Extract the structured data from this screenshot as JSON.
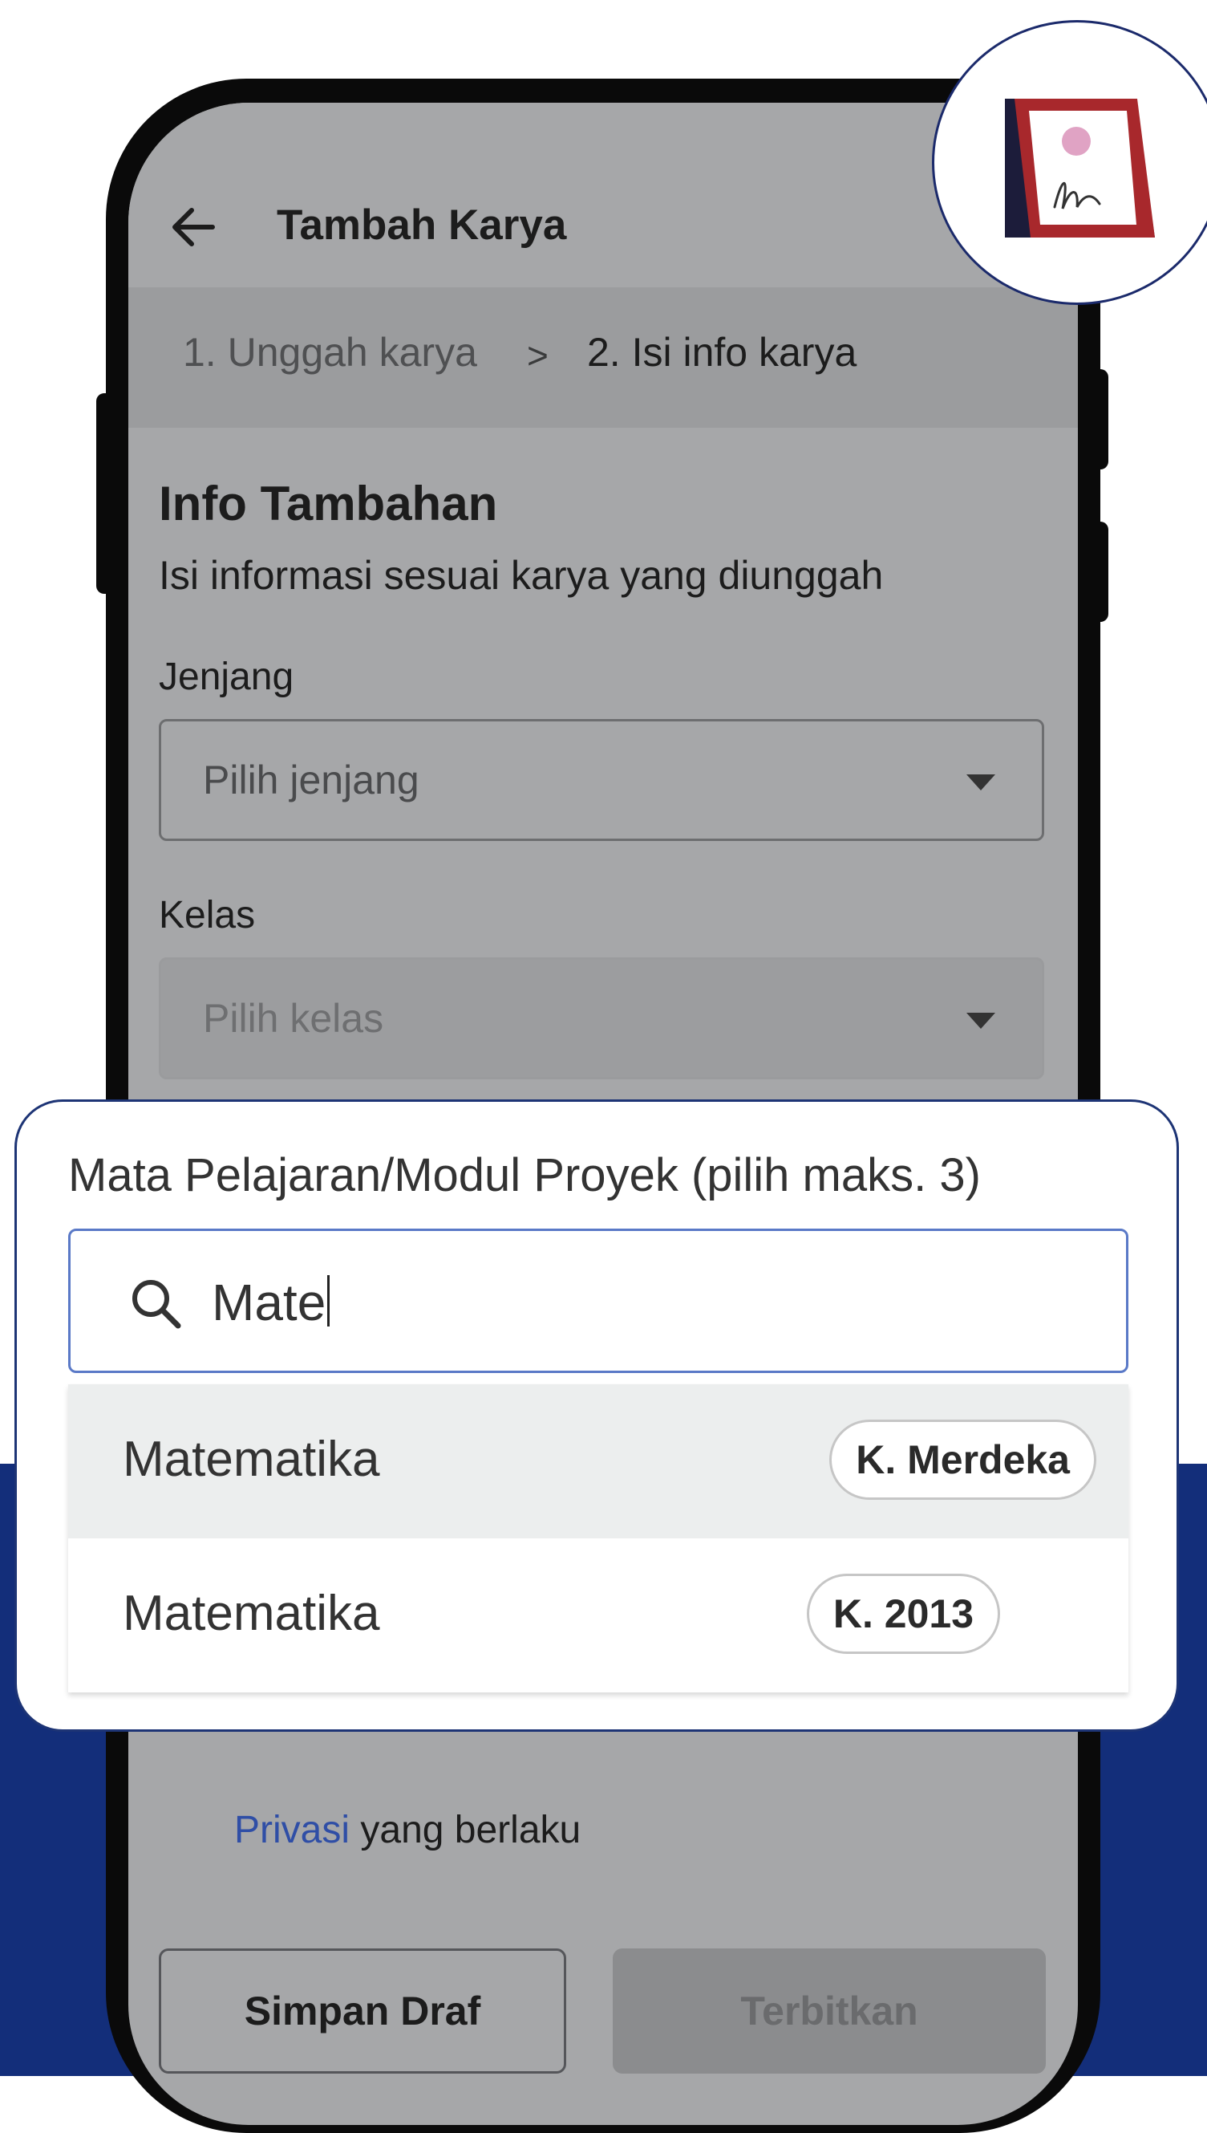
{
  "app": {
    "title": "Tambah Karya",
    "steps": [
      {
        "label": "1. Unggah karya"
      },
      {
        "label": "2. Isi info karya"
      }
    ]
  },
  "section": {
    "title": "Info Tambahan",
    "subtitle": "Isi informasi sesuai karya yang diunggah"
  },
  "fields": {
    "jenjang": {
      "label": "Jenjang",
      "placeholder": "Pilih jenjang"
    },
    "kelas": {
      "label": "Kelas",
      "placeholder": "Pilih kelas"
    }
  },
  "subject_picker": {
    "label": "Mata Pelajaran/Modul Proyek (pilih maks. 3)",
    "search_value": "Mate",
    "options": [
      {
        "name": "Matematika",
        "curriculum": "K. Merdeka"
      },
      {
        "name": "Matematika",
        "curriculum": "K. 2013"
      }
    ]
  },
  "privacy": {
    "link_text": "Privasi",
    "rest_text": " yang berlaku"
  },
  "actions": {
    "draft_label": "Simpan Draf",
    "publish_label": "Terbitkan"
  },
  "colors": {
    "navy": "#132e7a",
    "accent_link": "#2f4ea6",
    "badge_frame": "#a8282c"
  }
}
